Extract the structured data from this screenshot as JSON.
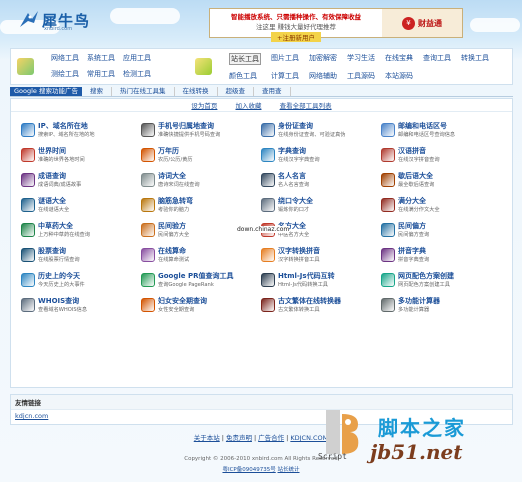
{
  "header": {
    "logo_text": "犀牛鸟",
    "logo_sub": "xnbird.com",
    "banner_line1": "智能播放系统、只需播种操作、有效保障收益",
    "banner_line2": "注这里  赚钱大量好代理推荐",
    "banner_button": "+注册新用户",
    "banner_brand": "财益通"
  },
  "nav": {
    "group1": [
      "网络工具",
      "系统工具",
      "应用工具",
      "测绘工具",
      "常用工具",
      "检测工具"
    ],
    "group2": [
      "站长工具",
      "图片工具",
      "加密解密",
      "学习生活",
      "在线宝典",
      "查询工具",
      "转换工具",
      "颜色工具",
      "计算工具",
      "网络辅助",
      "工具源码",
      "本站源码"
    ],
    "current": "站长工具"
  },
  "tabs": [
    "Google 搜索功能广告",
    "搜索",
    "热门在线工具集",
    "在线转换",
    "超级查",
    "查用查"
  ],
  "toplinks": [
    "设为首页",
    "加入收藏",
    "查看全部工具列表"
  ],
  "tools": [
    {
      "t": "IP、域名所在地",
      "d": "搜索IP、域名所在地的地",
      "c": "#2f7cc4"
    },
    {
      "t": "手机号归属地查询",
      "d": "准确快捷提供手机号码查询",
      "c": "#555"
    },
    {
      "t": "身份证查询",
      "d": "在线身份证查询、可验证真伪",
      "c": "#3b6ea8"
    },
    {
      "t": "邮编和电话区号",
      "d": "邮编和电话区号查询信息",
      "c": "#4a83c9"
    },
    {
      "t": "世界时间",
      "d": "准确的世界各地时间",
      "c": "#c0392b"
    },
    {
      "t": "万年历",
      "d": "农历/公历/黄历",
      "c": "#d35400"
    },
    {
      "t": "字典查询",
      "d": "在线汉字字典查询",
      "c": "#2e86c1"
    },
    {
      "t": "汉语拼音",
      "d": "在线汉字拼音查询",
      "c": "#b03a2e"
    },
    {
      "t": "成语查询",
      "d": "成语词典/成语故事",
      "c": "#6c3483"
    },
    {
      "t": "诗词大全",
      "d": "唐诗宋词在线查询",
      "c": "#7f8c8d"
    },
    {
      "t": "名人名言",
      "d": "名人名言查询",
      "c": "#34495e"
    },
    {
      "t": "歇后语大全",
      "d": "最全歇后语查询",
      "c": "#a04000"
    },
    {
      "t": "谜语大全",
      "d": "在线谜语大全",
      "c": "#1f618d"
    },
    {
      "t": "脑筋急转弯",
      "d": "考验你的脑力",
      "c": "#b9770e"
    },
    {
      "t": "绕口令大全",
      "d": "锻炼你的口才",
      "c": "#5d6d7e"
    },
    {
      "t": "满分大全",
      "d": "在线满分作文大全",
      "c": "#922b21"
    },
    {
      "t": "中草药大全",
      "d": "上万种中草药在线查询",
      "c": "#1e8449"
    },
    {
      "t": "民间验方",
      "d": "民间偏方大全",
      "c": "#ca6f1e"
    },
    {
      "t": "名方大全",
      "d": "中医名方大全",
      "c": "#c0392b"
    },
    {
      "t": "民间偏方",
      "d": "民间偏方查询",
      "c": "#2471a3"
    },
    {
      "t": "股票查询",
      "d": "在线股票行情查询",
      "c": "#1a5276"
    },
    {
      "t": "在线算命",
      "d": "在线算命测试",
      "c": "#884ea0"
    },
    {
      "t": "汉字转换拼音",
      "d": "汉字转换拼音工具",
      "c": "#e67e22"
    },
    {
      "t": "拼音字典",
      "d": "拼音字典查询",
      "c": "#6c3483"
    },
    {
      "t": "历史上的今天",
      "d": "今天历史上的大事件",
      "c": "#2e86c1"
    },
    {
      "t": "Google PR值查询工具",
      "d": "查询Google PageRank",
      "c": "#229954"
    },
    {
      "t": "Html-Js代码互转",
      "d": "Html-Js代码转换工具",
      "c": "#2c3e50"
    },
    {
      "t": "网页配色方案创建",
      "d": "网页配色方案创建工具",
      "c": "#17a589"
    },
    {
      "t": "WHOIS查询",
      "d": "查看域名WHOIS信息",
      "c": "#5d6d7e"
    },
    {
      "t": "妇女安全期查询",
      "d": "女性安全期查询",
      "c": "#d35400"
    },
    {
      "t": "古文繁体在线转换器",
      "d": "古文繁体转换工具",
      "c": "#7b241c"
    },
    {
      "t": "多功能计算器",
      "d": "多功能计算器",
      "c": "#616a6b"
    }
  ],
  "friend": {
    "header": "友情链接",
    "link": "kdjcn.com"
  },
  "footer": {
    "links": [
      "关于本站",
      "免责声明",
      "广告合作",
      "KDJCN.COM"
    ],
    "copyright": "Copyright © 2006-2010 xnbird.com All Rights Reserved",
    "icp": "粤ICP备09049735号",
    "icp_link": "站长统计"
  },
  "overlay": {
    "download_label": "down.chinaz.com",
    "script_label": "Script",
    "cn_brand": "脚本之家",
    "url_brand": "jb51.net"
  }
}
